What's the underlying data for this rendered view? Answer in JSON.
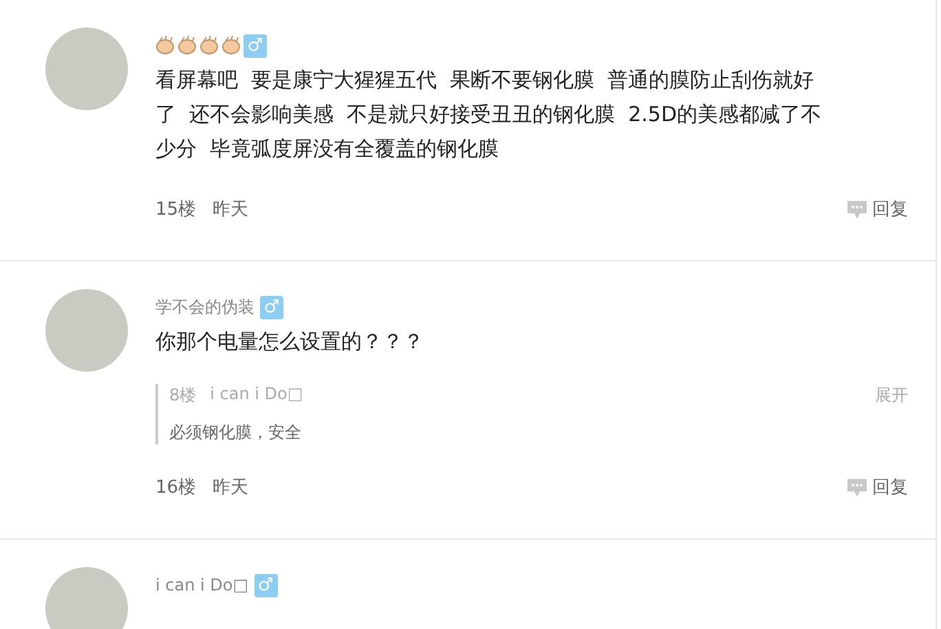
{
  "posts": [
    {
      "kind": "emoji",
      "gender": "♂",
      "text": "看屏幕吧  要是康宁大猩猩五代  果断不要钢化膜  普通的膜防止刮伤就好了  还不会影响美感  不是就只好接受丑丑的钢化膜  2.5D的美感都减了不少分  毕竟弧度屏没有全覆盖的钢化膜",
      "floor": "15楼",
      "time": "昨天",
      "reply": "回复"
    },
    {
      "kind": "text",
      "username": "学不会的伪装",
      "gender": "♂",
      "text": "你那个电量怎么设置的？？？",
      "floor": "16楼",
      "time": "昨天",
      "reply": "回复",
      "replies": [
        {
          "floor": "8楼",
          "user": "i can i Do□",
          "text": "必须钢化膜，安全",
          "expand": "展开"
        }
      ]
    },
    {
      "kind": "text",
      "username": "i can i Do□",
      "gender": "♂"
    }
  ]
}
